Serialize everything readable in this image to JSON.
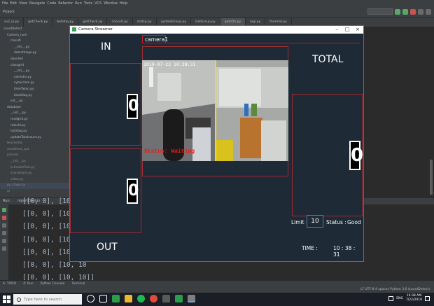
{
  "ide": {
    "menu": [
      "File",
      "Edit",
      "View",
      "Navigate",
      "Code",
      "Refactor",
      "Run",
      "Tools",
      "VCS",
      "Window",
      "Help"
    ],
    "project_label": "Project",
    "tabs": [
      "cv2_io.py",
      "getCheck.py",
      "bellstay.py",
      "getCheck.py",
      "consult.py",
      "statsp.py",
      "updateGroup.py",
      "GetGroup.py",
      "gateOn.py",
      "logi.py",
      "thermal.py"
    ],
    "tree": [
      "countDetect",
      "Camera_num",
      "classifi",
      "__init__.py",
      "detectdiago.py",
      "daunted",
      "classgrid",
      "__init__.py",
      "calender.py",
      "cyberclam.py",
      "timeTaken.py",
      "totaldiag.py",
      "init__.py",
      "database",
      "__init__.py",
      "readgrid.py",
      "rebuild.py",
      "lastdiag.py",
      "updateTotalcount.py",
      "Hosmedia",
      "modeltest_cpd",
      "process",
      "__init__.py",
      "scheduleText.py",
      "scoreboard.py",
      "video.py",
      "py_stage.py",
      "ui"
    ],
    "run_label": "Run:",
    "run_tab": "reportDesign",
    "console_lines": [
      "[[0, 0], [10, 10",
      "[[0, 0], [10, 10",
      "[[0, 0], [10, 10",
      "[[0, 0], [10, 10",
      "[[0, 0], [10, 10",
      "[[0, 0], [10, 10",
      "[[0, 0], [10, 10]]"
    ],
    "bottom_tabs": [
      "6: TODO",
      "4: Run",
      "Python Console",
      "Terminal"
    ],
    "status_right": "LF   UTF-8   4 spaces   Python 3.6 (countDetect)"
  },
  "taskbar": {
    "search_placeholder": "Type here to search",
    "lang": "ENG",
    "time": "10:38 AM",
    "date": "7/22/2019"
  },
  "app": {
    "window_title": "Camera Streamer",
    "camera_tab": "camera1",
    "in_label": "IN",
    "out_label": "OUT",
    "total_label": "TOTAL",
    "in_count": "0",
    "out_count": "0",
    "total_count": "0",
    "video_timestamp": "2019-07-22 10:38:31",
    "video_status": "Status: Waiting",
    "limit_label": "Limit :",
    "limit_value": "10",
    "status_label": "Status :",
    "status_value": "Good",
    "time_label": "TIME :",
    "time_value": "10 : 38 : 31"
  }
}
